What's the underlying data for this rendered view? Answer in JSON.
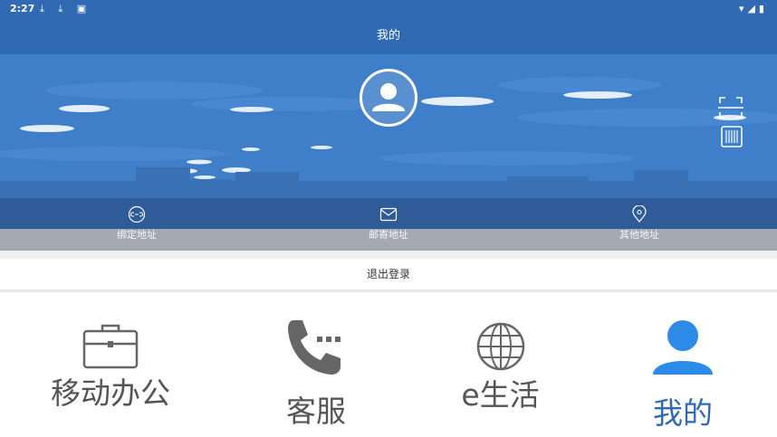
{
  "status_bar": {
    "time": "2:27",
    "left_icons": "⤓ ⤓ ▣",
    "right_icons": "▾◢▮"
  },
  "header": {
    "title": "我的"
  },
  "address_bar": {
    "items": [
      {
        "label": "绑定地址",
        "icon": "link-circle-icon"
      },
      {
        "label": "邮寄地址",
        "icon": "mail-icon"
      },
      {
        "label": "其他地址",
        "icon": "location-pin-icon"
      }
    ]
  },
  "logout": {
    "label": "退出登录"
  },
  "bottom_nav": {
    "tabs": [
      {
        "label": "移动办公",
        "icon": "briefcase-icon",
        "active": false
      },
      {
        "label": "客服",
        "icon": "phone-icon",
        "active": false
      },
      {
        "label": "e生活",
        "icon": "globe-icon",
        "active": false
      },
      {
        "label": "我的",
        "icon": "person-icon",
        "active": true
      }
    ]
  },
  "colors": {
    "primary": "#2f6ab2",
    "hero": "#3f7ec9",
    "active_tab": "#2f6ab2",
    "inactive_tab": "#555555"
  }
}
